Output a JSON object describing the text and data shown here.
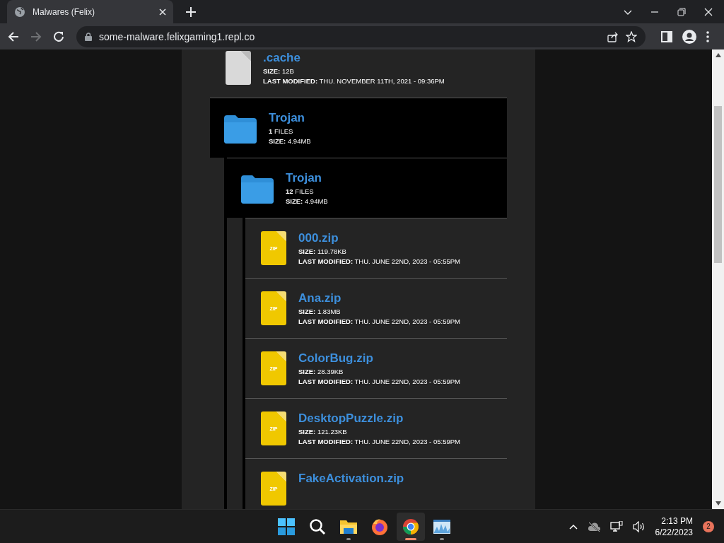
{
  "browser": {
    "tab_title": "Malwares (Felix)",
    "url": "some-malware.felixgaming1.repl.co",
    "forward_disabled": true
  },
  "listing": {
    "items": [
      {
        "kind": "file",
        "name": ".cache",
        "meta": [
          "**SIZE:** 12B",
          "**LAST MODIFIED:** THU. NOVEMBER 11TH, 2021 - 09:36PM"
        ]
      },
      {
        "kind": "folder",
        "name": "Trojan",
        "meta": [
          "**1** FILES",
          "**SIZE:** 4.94MB"
        ],
        "children": [
          {
            "kind": "folder",
            "name": "Trojan",
            "meta": [
              "**12** FILES",
              "**SIZE:** 4.94MB"
            ],
            "children": [
              {
                "kind": "zip",
                "icon_label": "ZIP",
                "name": "000.zip",
                "meta": [
                  "**SIZE:** 119.78KB",
                  "**LAST MODIFIED:** THU. JUNE 22ND, 2023 - 05:55PM"
                ]
              },
              {
                "kind": "zip",
                "icon_label": "ZIP",
                "name": "Ana.zip",
                "meta": [
                  "**SIZE:** 1.83MB",
                  "**LAST MODIFIED:** THU. JUNE 22ND, 2023 - 05:59PM"
                ]
              },
              {
                "kind": "zip",
                "icon_label": "ZIP",
                "name": "ColorBug.zip",
                "meta": [
                  "**SIZE:** 28.39KB",
                  "**LAST MODIFIED:** THU. JUNE 22ND, 2023 - 05:59PM"
                ]
              },
              {
                "kind": "zip",
                "icon_label": "ZIP",
                "name": "DesktopPuzzle.zip",
                "meta": [
                  "**SIZE:** 121.23KB",
                  "**LAST MODIFIED:** THU. JUNE 22ND, 2023 - 05:59PM"
                ]
              },
              {
                "kind": "zip",
                "icon_label": "ZIP",
                "name": "FakeActivation.zip"
              }
            ]
          }
        ]
      }
    ]
  },
  "taskbar": {
    "apps": [
      {
        "kind": "start",
        "running": false,
        "selected": false
      },
      {
        "kind": "search",
        "running": false,
        "selected": false
      },
      {
        "kind": "explorer",
        "running": true,
        "selected": false
      },
      {
        "kind": "firefox",
        "running": false,
        "selected": false
      },
      {
        "kind": "chrome",
        "running": true,
        "selected": true
      },
      {
        "kind": "monitor",
        "running": true,
        "selected": false
      }
    ],
    "time": "2:13 PM",
    "date": "6/22/2023",
    "notifications": "2"
  }
}
